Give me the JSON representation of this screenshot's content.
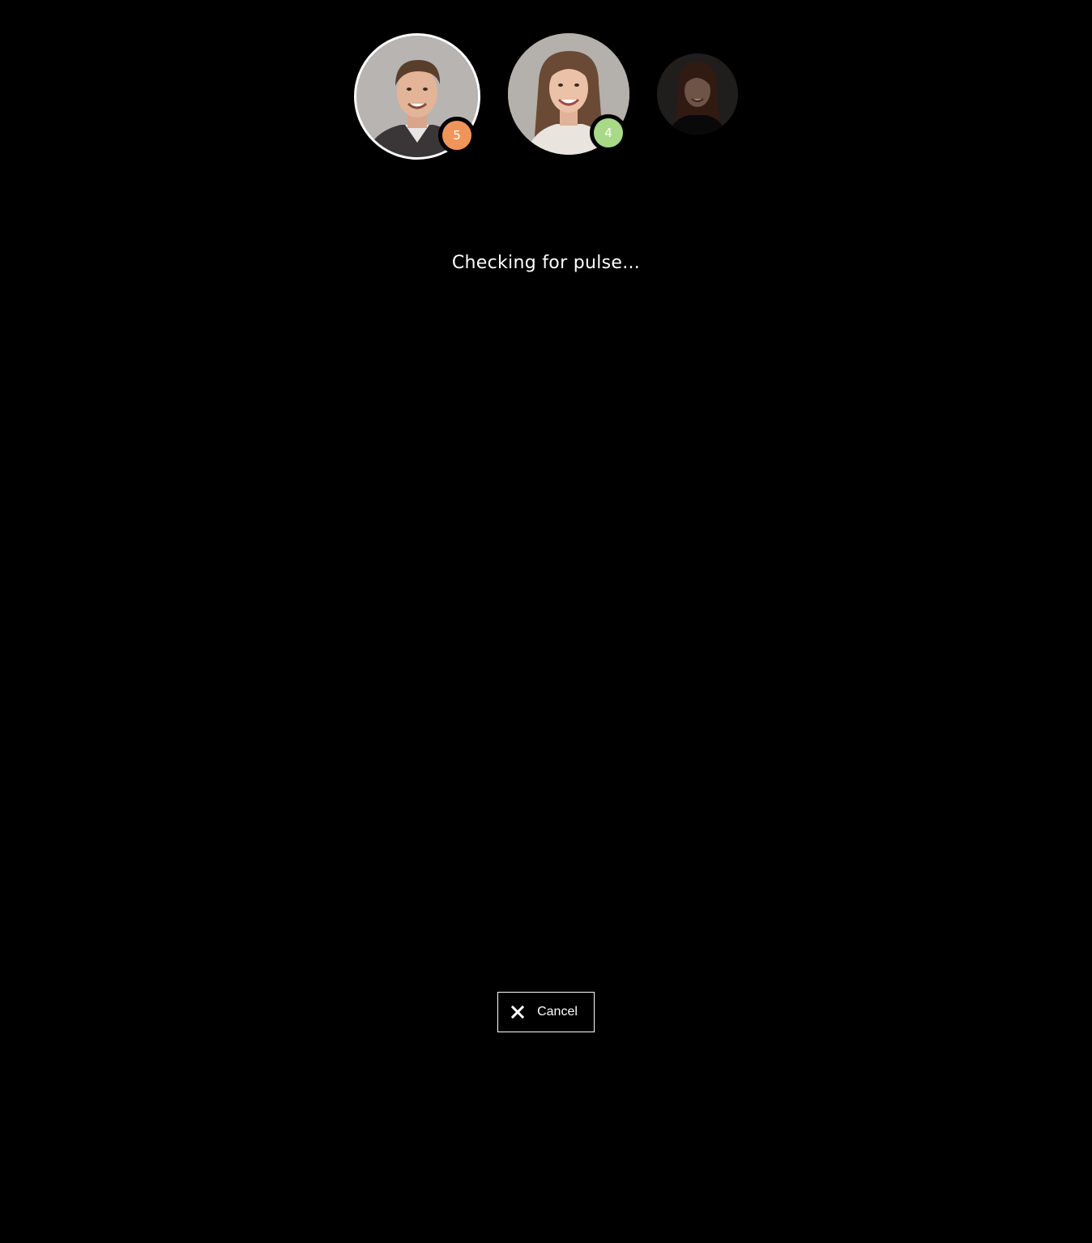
{
  "avatars": [
    {
      "name": "avatar-user-1",
      "badge": "5",
      "badge_color": "#f0955a",
      "selected": true
    },
    {
      "name": "avatar-user-2",
      "badge": "4",
      "badge_color": "#a8d989",
      "selected": false
    },
    {
      "name": "avatar-user-3",
      "badge": null,
      "dimmed": true
    }
  ],
  "status": {
    "text": "Checking for pulse..."
  },
  "cancel": {
    "label": "Cancel",
    "icon": "close-icon"
  },
  "colors": {
    "background": "#000000",
    "foreground": "#ffffff"
  }
}
